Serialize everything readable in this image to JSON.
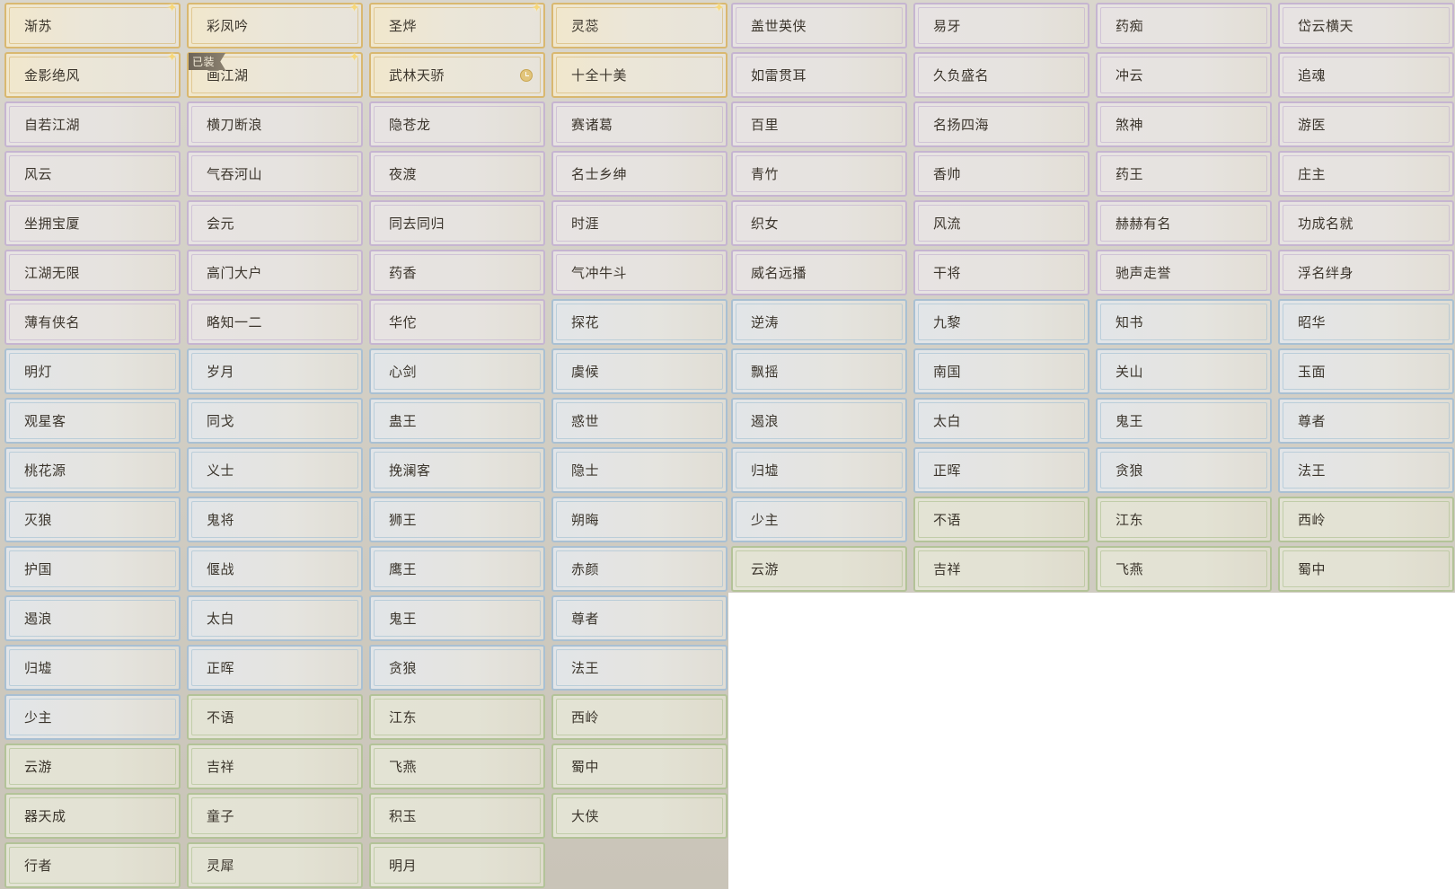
{
  "equipped_badge": "已装",
  "titles": [
    {
      "label": "渐苏",
      "tier": "gold",
      "sparkle": true
    },
    {
      "label": "彩凤吟",
      "tier": "gold",
      "sparkle": true
    },
    {
      "label": "圣烨",
      "tier": "gold",
      "sparkle": true
    },
    {
      "label": "灵蕊",
      "tier": "gold",
      "sparkle": true
    },
    {
      "label": "盖世英侠",
      "tier": "purple"
    },
    {
      "label": "易牙",
      "tier": "purple"
    },
    {
      "label": "药痴",
      "tier": "purple"
    },
    {
      "label": "岱云横天",
      "tier": "purple"
    },
    {
      "label": "金影绝风",
      "tier": "gold",
      "sparkle": true
    },
    {
      "label": "画江湖",
      "tier": "gold",
      "sparkle": true,
      "equipped": true
    },
    {
      "label": "武林天骄",
      "tier": "gold",
      "clock": true
    },
    {
      "label": "十全十美",
      "tier": "gold"
    },
    {
      "label": "如雷贯耳",
      "tier": "purple"
    },
    {
      "label": "久负盛名",
      "tier": "purple"
    },
    {
      "label": "冲云",
      "tier": "purple"
    },
    {
      "label": "追魂",
      "tier": "purple"
    },
    {
      "label": "自若江湖",
      "tier": "purple"
    },
    {
      "label": "横刀断浪",
      "tier": "purple"
    },
    {
      "label": "隐苍龙",
      "tier": "purple"
    },
    {
      "label": "赛诸葛",
      "tier": "purple"
    },
    {
      "label": "百里",
      "tier": "purple"
    },
    {
      "label": "名扬四海",
      "tier": "purple"
    },
    {
      "label": "煞神",
      "tier": "purple"
    },
    {
      "label": "游医",
      "tier": "purple"
    },
    {
      "label": "风云",
      "tier": "purple"
    },
    {
      "label": "气吞河山",
      "tier": "purple"
    },
    {
      "label": "夜渡",
      "tier": "purple"
    },
    {
      "label": "名士乡绅",
      "tier": "purple"
    },
    {
      "label": "青竹",
      "tier": "purple"
    },
    {
      "label": "香帅",
      "tier": "purple"
    },
    {
      "label": "药王",
      "tier": "purple"
    },
    {
      "label": "庄主",
      "tier": "purple"
    },
    {
      "label": "坐拥宝厦",
      "tier": "purple"
    },
    {
      "label": "会元",
      "tier": "purple"
    },
    {
      "label": "同去同归",
      "tier": "purple"
    },
    {
      "label": "时涯",
      "tier": "purple"
    },
    {
      "label": "织女",
      "tier": "purple"
    },
    {
      "label": "风流",
      "tier": "purple"
    },
    {
      "label": "赫赫有名",
      "tier": "purple"
    },
    {
      "label": "功成名就",
      "tier": "purple"
    },
    {
      "label": "江湖无限",
      "tier": "purple"
    },
    {
      "label": "高门大户",
      "tier": "purple"
    },
    {
      "label": "药香",
      "tier": "purple"
    },
    {
      "label": "气冲牛斗",
      "tier": "purple"
    },
    {
      "label": "威名远播",
      "tier": "purple"
    },
    {
      "label": "干将",
      "tier": "purple"
    },
    {
      "label": "驰声走誉",
      "tier": "purple"
    },
    {
      "label": "浮名绊身",
      "tier": "purple"
    },
    {
      "label": "薄有侠名",
      "tier": "purple"
    },
    {
      "label": "略知一二",
      "tier": "purple"
    },
    {
      "label": "华佗",
      "tier": "purple"
    },
    {
      "label": "探花",
      "tier": "blue"
    },
    {
      "label": "逆涛",
      "tier": "blue"
    },
    {
      "label": "九黎",
      "tier": "blue"
    },
    {
      "label": "知书",
      "tier": "blue"
    },
    {
      "label": "昭华",
      "tier": "blue"
    },
    {
      "label": "明灯",
      "tier": "blue"
    },
    {
      "label": "岁月",
      "tier": "blue"
    },
    {
      "label": "心剑",
      "tier": "blue"
    },
    {
      "label": "虞候",
      "tier": "blue"
    },
    {
      "label": "飘摇",
      "tier": "blue"
    },
    {
      "label": "南国",
      "tier": "blue"
    },
    {
      "label": "关山",
      "tier": "blue"
    },
    {
      "label": "玉面",
      "tier": "blue"
    },
    {
      "label": "观星客",
      "tier": "blue"
    },
    {
      "label": "同戈",
      "tier": "blue"
    },
    {
      "label": "蛊王",
      "tier": "blue"
    },
    {
      "label": "惑世",
      "tier": "blue"
    },
    {
      "label": "遏浪",
      "tier": "blue"
    },
    {
      "label": "太白",
      "tier": "blue"
    },
    {
      "label": "鬼王",
      "tier": "blue"
    },
    {
      "label": "尊者",
      "tier": "blue"
    },
    {
      "label": "桃花源",
      "tier": "blue"
    },
    {
      "label": "义士",
      "tier": "blue"
    },
    {
      "label": "挽澜客",
      "tier": "blue"
    },
    {
      "label": "隐士",
      "tier": "blue"
    },
    {
      "label": "归墟",
      "tier": "blue"
    },
    {
      "label": "正晖",
      "tier": "blue"
    },
    {
      "label": "贪狼",
      "tier": "blue"
    },
    {
      "label": "法王",
      "tier": "blue"
    },
    {
      "label": "灭狼",
      "tier": "blue"
    },
    {
      "label": "鬼将",
      "tier": "blue"
    },
    {
      "label": "狮王",
      "tier": "blue"
    },
    {
      "label": "朔晦",
      "tier": "blue"
    },
    {
      "label": "少主",
      "tier": "blue"
    },
    {
      "label": "不语",
      "tier": "green"
    },
    {
      "label": "江东",
      "tier": "green"
    },
    {
      "label": "西岭",
      "tier": "green"
    },
    {
      "label": "护国",
      "tier": "blue"
    },
    {
      "label": "偃战",
      "tier": "blue"
    },
    {
      "label": "鹰王",
      "tier": "blue"
    },
    {
      "label": "赤颜",
      "tier": "blue"
    },
    {
      "label": "云游",
      "tier": "green"
    },
    {
      "label": "吉祥",
      "tier": "green"
    },
    {
      "label": "飞燕",
      "tier": "green"
    },
    {
      "label": "蜀中",
      "tier": "green"
    },
    {
      "label": "遏浪",
      "tier": "blue"
    },
    {
      "label": "太白",
      "tier": "blue"
    },
    {
      "label": "鬼王",
      "tier": "blue"
    },
    {
      "label": "尊者",
      "tier": "blue"
    },
    {
      "label": "归墟",
      "tier": "blue"
    },
    {
      "label": "正晖",
      "tier": "blue"
    },
    {
      "label": "贪狼",
      "tier": "blue"
    },
    {
      "label": "法王",
      "tier": "blue"
    },
    {
      "label": "少主",
      "tier": "blue"
    },
    {
      "label": "不语",
      "tier": "green"
    },
    {
      "label": "江东",
      "tier": "green"
    },
    {
      "label": "西岭",
      "tier": "green"
    },
    {
      "label": "云游",
      "tier": "green"
    },
    {
      "label": "吉祥",
      "tier": "green"
    },
    {
      "label": "飞燕",
      "tier": "green"
    },
    {
      "label": "蜀中",
      "tier": "green"
    },
    {
      "label": "器天成",
      "tier": "green"
    },
    {
      "label": "童子",
      "tier": "green"
    },
    {
      "label": "积玉",
      "tier": "green"
    },
    {
      "label": "大侠",
      "tier": "green"
    },
    {
      "label": "行者",
      "tier": "green"
    },
    {
      "label": "灵犀",
      "tier": "green"
    },
    {
      "label": "明月",
      "tier": "green"
    }
  ]
}
